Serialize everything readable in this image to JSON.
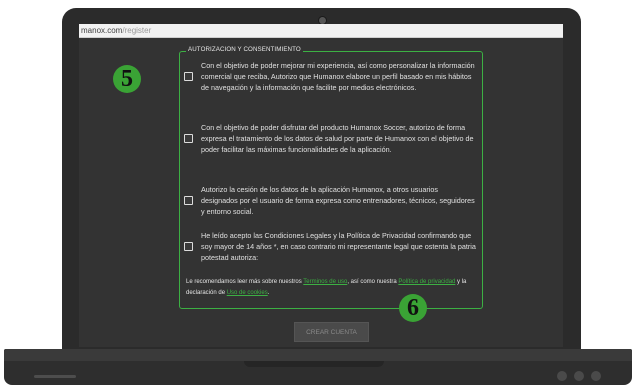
{
  "browser": {
    "url_domain": "manox.com",
    "url_path": "/register"
  },
  "form": {
    "legend": "AUTORIZACION Y CONSENTIMIENTO",
    "items": [
      {
        "text": "Con el objetivo de poder mejorar mi experiencia, así como personalizar la información comercial que reciba, Autorizo que Humanox elabore un perfil basado en mis hábitos de navegación y la información que facilite por medios electrónicos.",
        "checked": false
      },
      {
        "text": "Con el objetivo de poder disfrutar del producto Humanox Soccer, autorizo de forma expresa el tratamiento de los datos de salud por parte de Humanox con el objetivo de poder facilitar las máximas funcionalidades de la aplicación.",
        "checked": false
      },
      {
        "text": "Autorizo la cesión de los datos de la aplicación Humanox, a otros usuarios designados por el usuario de forma expresa como entrenadores, técnicos, seguidores y entorno social.",
        "checked": false
      },
      {
        "text": "He leído acepto las Condiciones Legales y la Política de Privacidad confirmando que soy mayor de 14 años *, en caso contrario mi representante legal que ostenta la patria potestad autoriza:",
        "checked": false
      }
    ],
    "footer": {
      "prefix": "Le recomendamos leer más sobre nuestros ",
      "link_terms": "Terminos de uso",
      "middle": ", así como nuestra ",
      "link_privacy": "Política de privacidad",
      "middle2": " y la declaración de ",
      "link_cookies": "Uso de cookies",
      "suffix": "."
    },
    "submit_label": "CREAR CUENTA"
  },
  "annotations": {
    "step_5": "5",
    "step_6": "6"
  },
  "colors": {
    "accent": "#3cb043",
    "screen_bg": "#333333",
    "badge": "#3aa335"
  }
}
